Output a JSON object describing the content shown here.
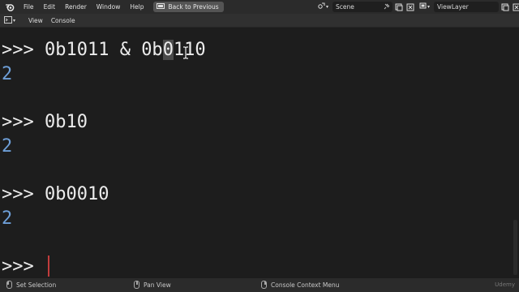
{
  "topbar": {
    "menus": [
      "File",
      "Edit",
      "Render",
      "Window",
      "Help"
    ],
    "back_button": "Back to Previous",
    "scene_label": "Scene",
    "view_layer_label": "ViewLayer"
  },
  "header": {
    "menus": [
      "View",
      "Console"
    ]
  },
  "console": {
    "lines": [
      {
        "prompt": ">>> ",
        "pre": "0b1011 & 0b",
        "highlight": "0",
        "post": "110"
      },
      {
        "output": "2"
      },
      {
        "prompt": ">>> ",
        "text": "0b10"
      },
      {
        "output": "2"
      },
      {
        "prompt": ">>> ",
        "text": "0b0010"
      },
      {
        "output": "2"
      },
      {
        "prompt": ">>> ",
        "text": ""
      }
    ]
  },
  "statusbar": {
    "left": "Set Selection",
    "middle": "Pan View",
    "right": "Console Context Menu",
    "watermark": "Udemy"
  },
  "colors": {
    "output": "#6e9fd8",
    "cursor": "#c23c3c",
    "background": "#1d1d1d"
  }
}
